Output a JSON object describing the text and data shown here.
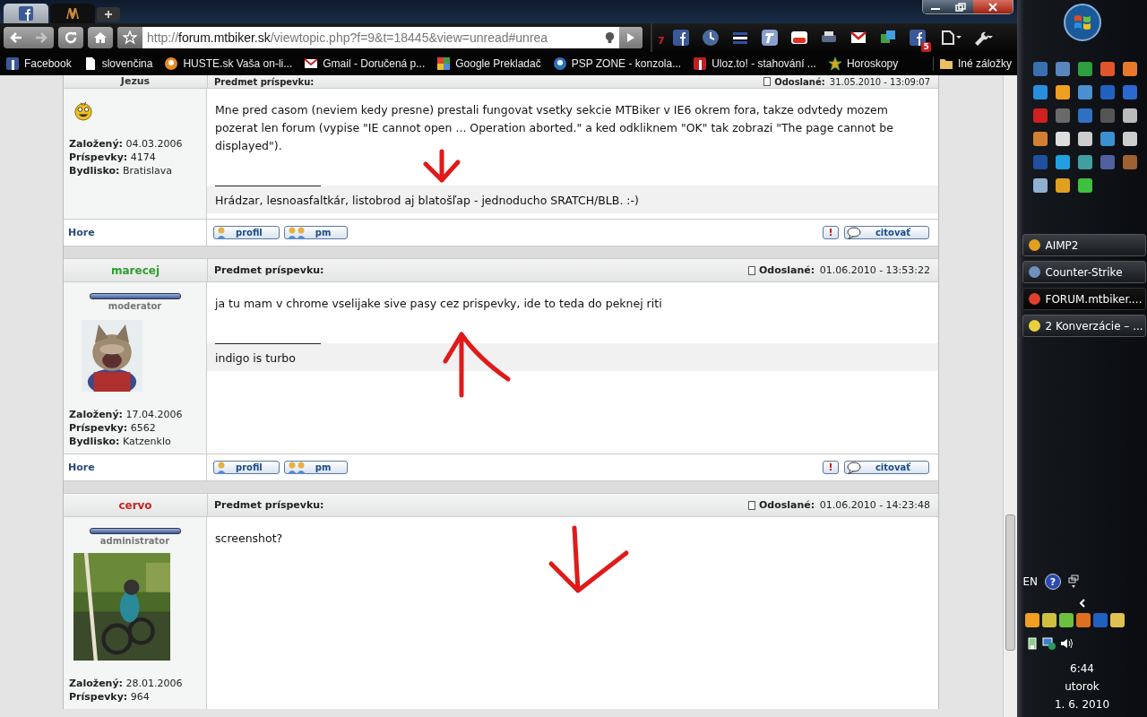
{
  "browser": {
    "tabs": [
      {
        "kind": "social",
        "selected": false
      },
      {
        "kind": "forum",
        "selected": true
      }
    ],
    "nav": {
      "forward_disabled": true
    },
    "address": {
      "scheme": "http://",
      "host": "forum.mtbiker.sk",
      "path": "/viewtopic.php?f=9&t=18445&view=unread#unrea"
    },
    "extensions": [
      {
        "kind": "counter",
        "label": "7"
      },
      {
        "kind": "social"
      },
      {
        "kind": "clock"
      },
      {
        "kind": "lines"
      },
      {
        "kind": "tool"
      },
      {
        "kind": "video"
      },
      {
        "kind": "printer"
      },
      {
        "kind": "mail"
      },
      {
        "kind": "windows"
      },
      {
        "kind": "social",
        "badge": "5"
      }
    ],
    "bookmarks": [
      {
        "kind": "social",
        "label": "Facebook"
      },
      {
        "kind": "page",
        "label": "slovenčina"
      },
      {
        "kind": "orange",
        "label": "HUSTE.sk Vaša on-li..."
      },
      {
        "kind": "mail",
        "label": "Gmail - Doručená p..."
      },
      {
        "kind": "translate",
        "label": "Google Prekladač"
      },
      {
        "kind": "psp",
        "label": "PSP ZONE - konzola..."
      },
      {
        "kind": "uloz",
        "label": "Uloz.to! - stahování ..."
      },
      {
        "kind": "star",
        "label": "Horoskopy"
      }
    ],
    "other_bookmarks": "Iné záložky"
  },
  "posts": [
    {
      "author": "Jezus",
      "color": "#333333",
      "avatar": {
        "kind": "smiley"
      },
      "subject_label": "Predmet príspevku:",
      "posted_label": "Odoslané:",
      "posted": "31.05.2010 - 13:09:07",
      "stats": [
        {
          "label": "Založený:",
          "value": "04.03.2006"
        },
        {
          "label": "Príspevky:",
          "value": "4174"
        },
        {
          "label": "Bydlisko:",
          "value": "Bratislava"
        }
      ],
      "body": "Mne pred casom (neviem kedy presne) prestali fungovat vsetky sekcie MTBiker v IE6 okrem fora, takze odvtedy mozem pozerat len forum (vypise \"IE cannot open ... Operation aborted.\" a ked odkliknem \"OK\" tak zobrazi \"The page cannot be displayed\").",
      "signature": "Hrádzar, lesnoasfaltkár, listobrod aj blatošľap - jednoducho SRATCH/BLB. :-)",
      "footer": {
        "top_link": "Hore",
        "buttons": [
          "profil",
          "pm"
        ],
        "report": "!",
        "quote": "citovať"
      },
      "annotation": {
        "kind": "down"
      }
    },
    {
      "author": "marecej",
      "color": "#2e9e2e",
      "rank": "moderator",
      "avatar": {
        "kind": "picture"
      },
      "subject_label": "Predmet príspevku:",
      "posted_label": "Odoslané:",
      "posted": "01.06.2010 - 13:53:22",
      "stats": [
        {
          "label": "Založený:",
          "value": "17.04.2006"
        },
        {
          "label": "Príspevky:",
          "value": "6562"
        },
        {
          "label": "Bydlisko:",
          "value": "Katzenklo"
        }
      ],
      "body": "ja tu mam v chrome vselijake sive pasy cez prispevky, ide to teda do peknej riti",
      "signature": "indigo is turbo",
      "footer": {
        "top_link": "Hore",
        "buttons": [
          "profil",
          "pm"
        ],
        "report": "!",
        "quote": "citovať"
      },
      "annotation": {
        "kind": "up"
      }
    },
    {
      "author": "cervo",
      "color": "#cc2020",
      "rank": "administrator",
      "avatar": {
        "kind": "picture"
      },
      "subject_label": "Predmet príspevku:",
      "posted_label": "Odoslané:",
      "posted": "01.06.2010 - 14:23:48",
      "stats": [
        {
          "label": "Založený:",
          "value": "28.01.2006"
        },
        {
          "label": "Príspevky:",
          "value": "964"
        }
      ],
      "body": "screenshot?",
      "annotation": {
        "kind": "down"
      }
    }
  ],
  "taskbar": {
    "tasks": [
      {
        "label": "AIMP2",
        "kind": "player",
        "selected": false
      },
      {
        "label": "Counter-Strike",
        "kind": "game",
        "selected": false
      },
      {
        "label": "FORUM.mtbiker....",
        "kind": "browser",
        "selected": true
      },
      {
        "label": "2 Konverzácie – ...",
        "kind": "chat",
        "selected": false
      }
    ],
    "language": "EN",
    "help": "?",
    "time": "6:44",
    "day": "utorok",
    "date": "1. 6. 2010"
  }
}
